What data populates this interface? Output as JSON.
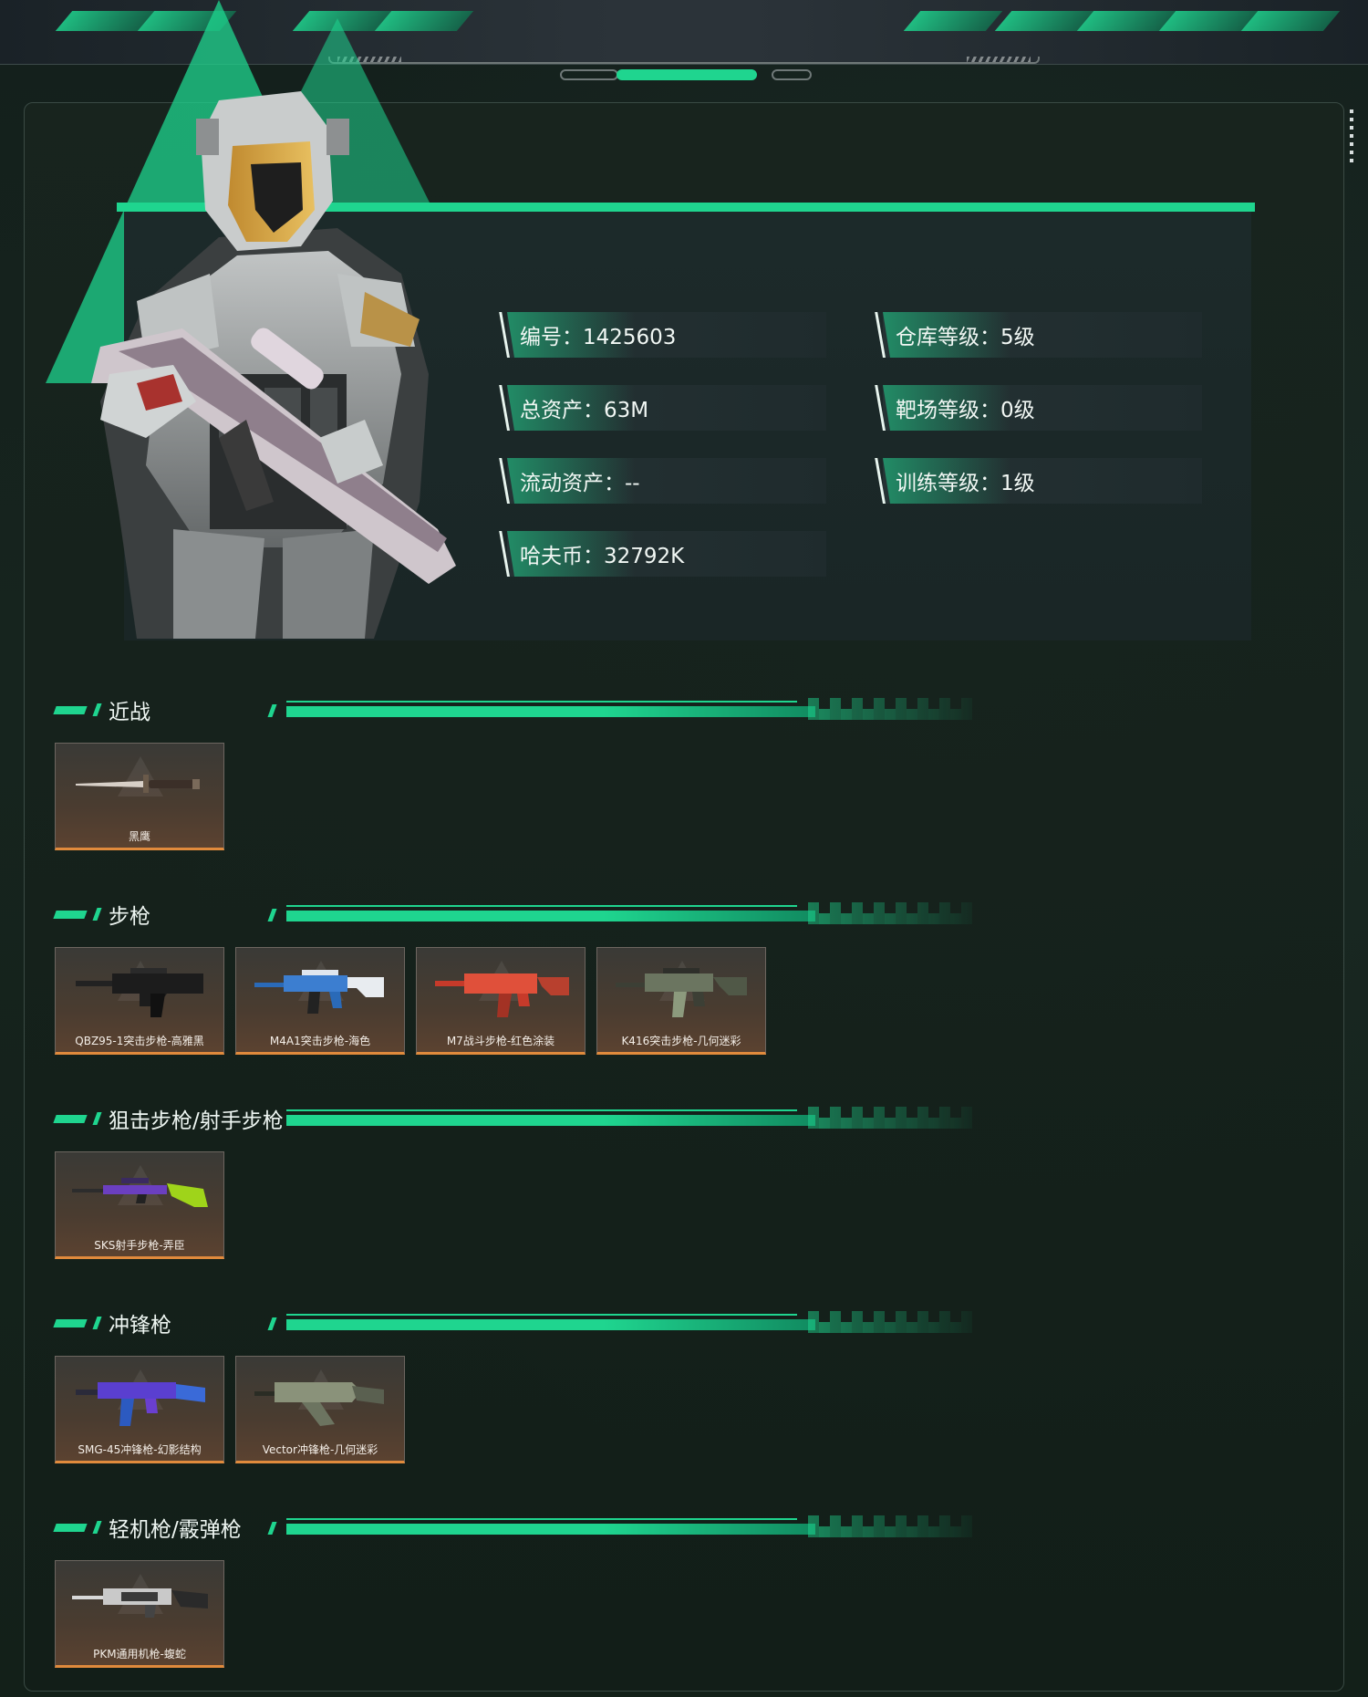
{
  "colors": {
    "accent": "#1fd58f",
    "card_border": "#e08a3c",
    "panel": "#1c2a2a"
  },
  "stats": {
    "id": "编号：1425603",
    "warehouse_level": "仓库等级：5级",
    "total_assets": "总资产：63M",
    "range_level": "靶场等级：0级",
    "liquid_assets": "流动资产：--",
    "training_level": "训练等级：1级",
    "havoc_coin": "哈夫币：32792K"
  },
  "categories": [
    {
      "title": "近战",
      "items": [
        {
          "name": "黑鹰",
          "icon": "knife-icon"
        }
      ]
    },
    {
      "title": "步枪",
      "items": [
        {
          "name": "QBZ95-1突击步枪-高雅黑",
          "icon": "rifle-icon"
        },
        {
          "name": "M4A1突击步枪-海色",
          "icon": "rifle-icon"
        },
        {
          "name": "M7战斗步枪-红色涂装",
          "icon": "rifle-icon"
        },
        {
          "name": "K416突击步枪-几何迷彩",
          "icon": "rifle-icon"
        }
      ]
    },
    {
      "title": "狙击步枪/射手步枪",
      "items": [
        {
          "name": "SKS射手步枪-弄臣",
          "icon": "sniper-rifle-icon"
        }
      ]
    },
    {
      "title": "冲锋枪",
      "items": [
        {
          "name": "SMG-45冲锋枪-幻影结构",
          "icon": "smg-icon"
        },
        {
          "name": "Vector冲锋枪-几何迷彩",
          "icon": "smg-icon"
        }
      ]
    },
    {
      "title": "轻机枪/霰弹枪",
      "items": [
        {
          "name": "PKM通用机枪-蝮蛇",
          "icon": "machine-gun-icon"
        }
      ]
    }
  ]
}
